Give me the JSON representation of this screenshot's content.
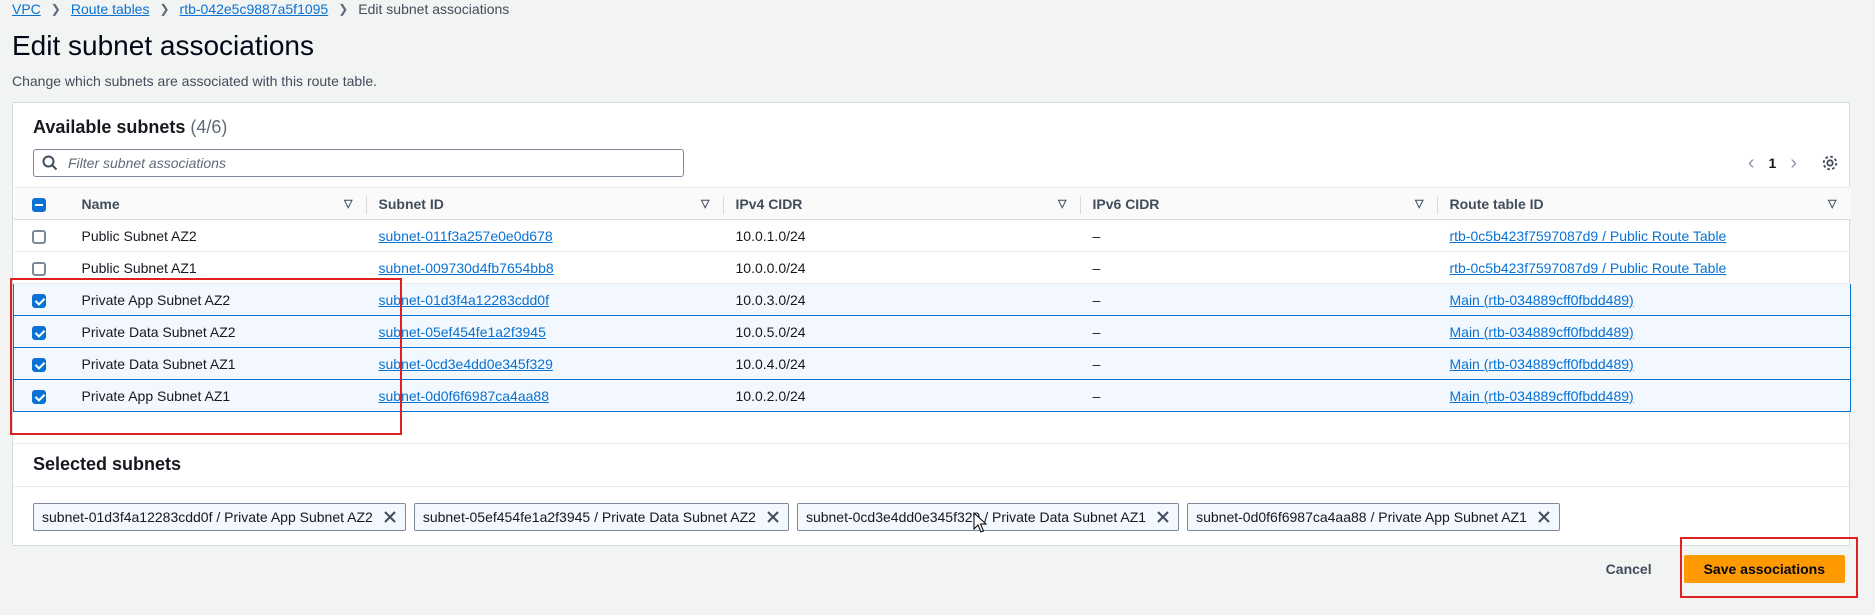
{
  "breadcrumb": [
    {
      "label": "VPC",
      "link": true
    },
    {
      "label": "Route tables",
      "link": true
    },
    {
      "label": "rtb-042e5c9887a5f1095",
      "link": true
    },
    {
      "label": "Edit subnet associations",
      "link": false
    }
  ],
  "page": {
    "title": "Edit subnet associations",
    "description": "Change which subnets are associated with this route table."
  },
  "available": {
    "title": "Available subnets",
    "count": "(4/6)",
    "filter_placeholder": "Filter subnet associations",
    "page_number": "1",
    "columns": [
      "Name",
      "Subnet ID",
      "IPv4 CIDR",
      "IPv6 CIDR",
      "Route table ID"
    ],
    "rows": [
      {
        "checked": false,
        "name": "Public Subnet AZ2",
        "subnet_id": "subnet-011f3a257e0e0d678",
        "ipv4": "10.0.1.0/24",
        "ipv6": "–",
        "route_table": "rtb-0c5b423f7597087d9 / Public Route Table"
      },
      {
        "checked": false,
        "name": "Public Subnet AZ1",
        "subnet_id": "subnet-009730d4fb7654bb8",
        "ipv4": "10.0.0.0/24",
        "ipv6": "–",
        "route_table": "rtb-0c5b423f7597087d9 / Public Route Table"
      },
      {
        "checked": true,
        "name": "Private App Subnet AZ2",
        "subnet_id": "subnet-01d3f4a12283cdd0f",
        "ipv4": "10.0.3.0/24",
        "ipv6": "–",
        "route_table": "Main (rtb-034889cff0fbdd489)"
      },
      {
        "checked": true,
        "name": "Private Data Subnet AZ2",
        "subnet_id": "subnet-05ef454fe1a2f3945",
        "ipv4": "10.0.5.0/24",
        "ipv6": "–",
        "route_table": "Main (rtb-034889cff0fbdd489)"
      },
      {
        "checked": true,
        "name": "Private Data Subnet AZ1",
        "subnet_id": "subnet-0cd3e4dd0e345f329",
        "ipv4": "10.0.4.0/24",
        "ipv6": "–",
        "route_table": "Main (rtb-034889cff0fbdd489)"
      },
      {
        "checked": true,
        "name": "Private App Subnet AZ1",
        "subnet_id": "subnet-0d0f6f6987ca4aa88",
        "ipv4": "10.0.2.0/24",
        "ipv6": "–",
        "route_table": "Main (rtb-034889cff0fbdd489)"
      }
    ]
  },
  "selected": {
    "title": "Selected subnets",
    "tokens": [
      "subnet-01d3f4a12283cdd0f / Private App Subnet AZ2",
      "subnet-05ef454fe1a2f3945 / Private Data Subnet AZ2",
      "subnet-0cd3e4dd0e345f329 / Private Data Subnet AZ1",
      "subnet-0d0f6f6987ca4aa88 / Private App Subnet AZ1"
    ]
  },
  "footer": {
    "cancel_label": "Cancel",
    "save_label": "Save associations"
  },
  "colors": {
    "accent": "#0972d3",
    "primary_button": "#ff9900",
    "annotation": "#e02020"
  }
}
